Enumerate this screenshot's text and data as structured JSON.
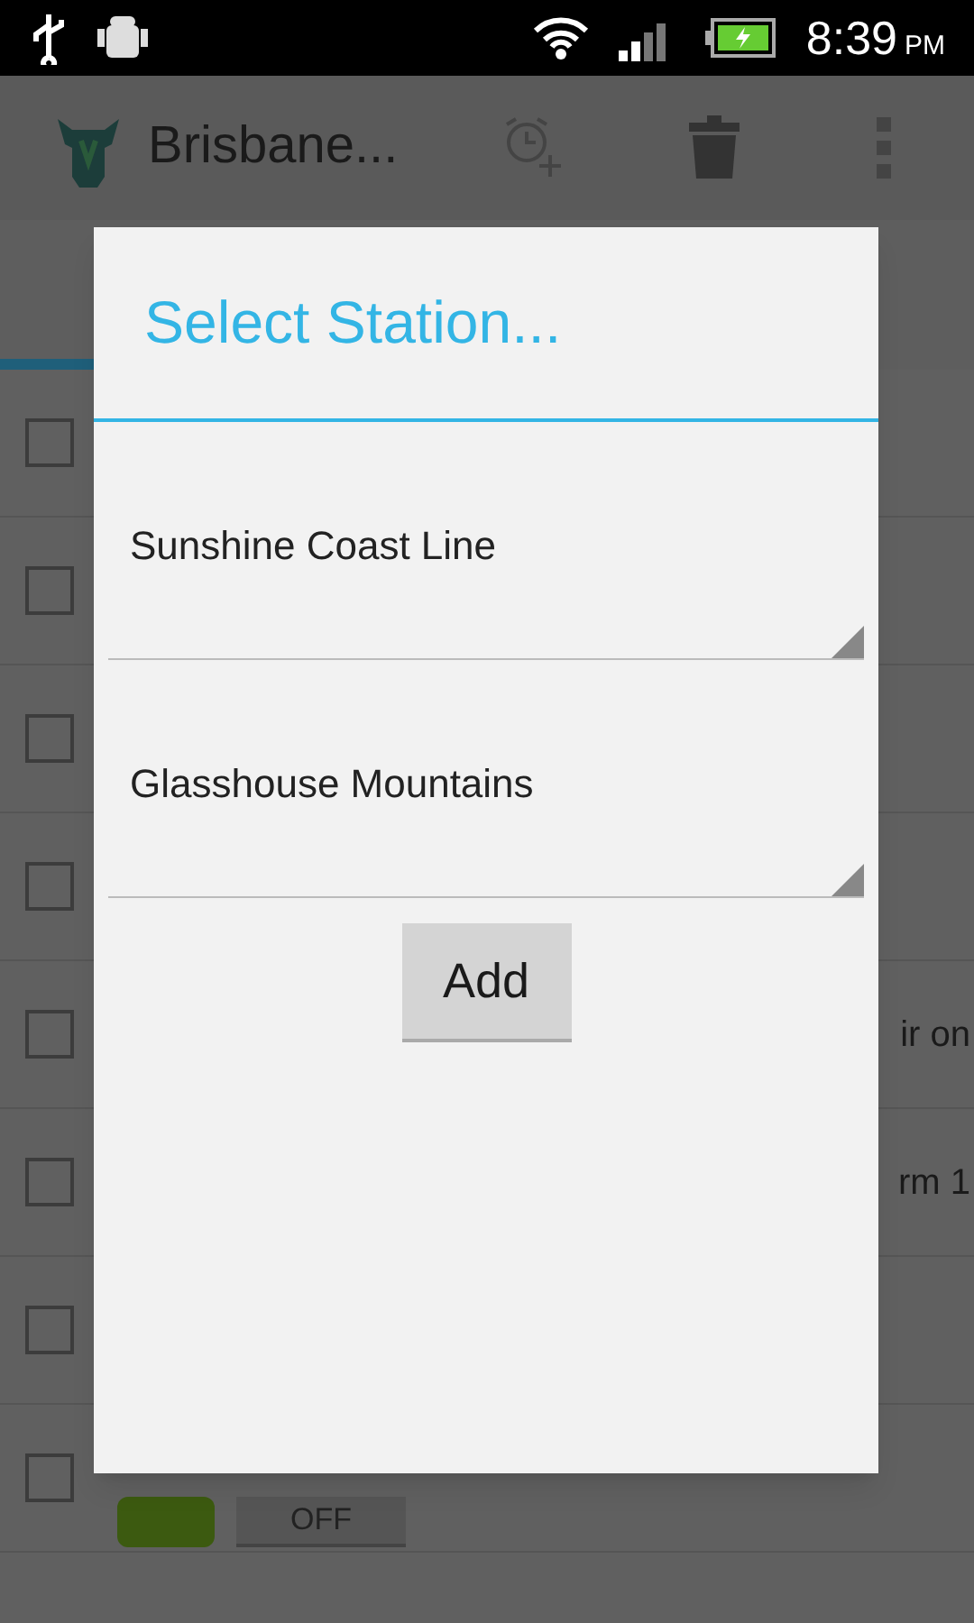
{
  "status_bar": {
    "time": "8:39",
    "meridiem": "PM"
  },
  "action_bar": {
    "title": "Brisbane..."
  },
  "rows": [
    {
      "checked": false
    },
    {
      "checked": false
    },
    {
      "checked": false
    },
    {
      "checked": false
    },
    {
      "checked": false,
      "trailing_text": "ir on"
    },
    {
      "checked": false,
      "trailing_text": "rm 1"
    },
    {
      "checked": false
    },
    {
      "checked": false,
      "toggle_label": "OFF",
      "toggle_on": false
    }
  ],
  "dialog": {
    "title": "Select Station...",
    "spinners": [
      {
        "value": "Sunshine Coast Line"
      },
      {
        "value": "Glasshouse Mountains"
      }
    ],
    "button": "Add"
  }
}
